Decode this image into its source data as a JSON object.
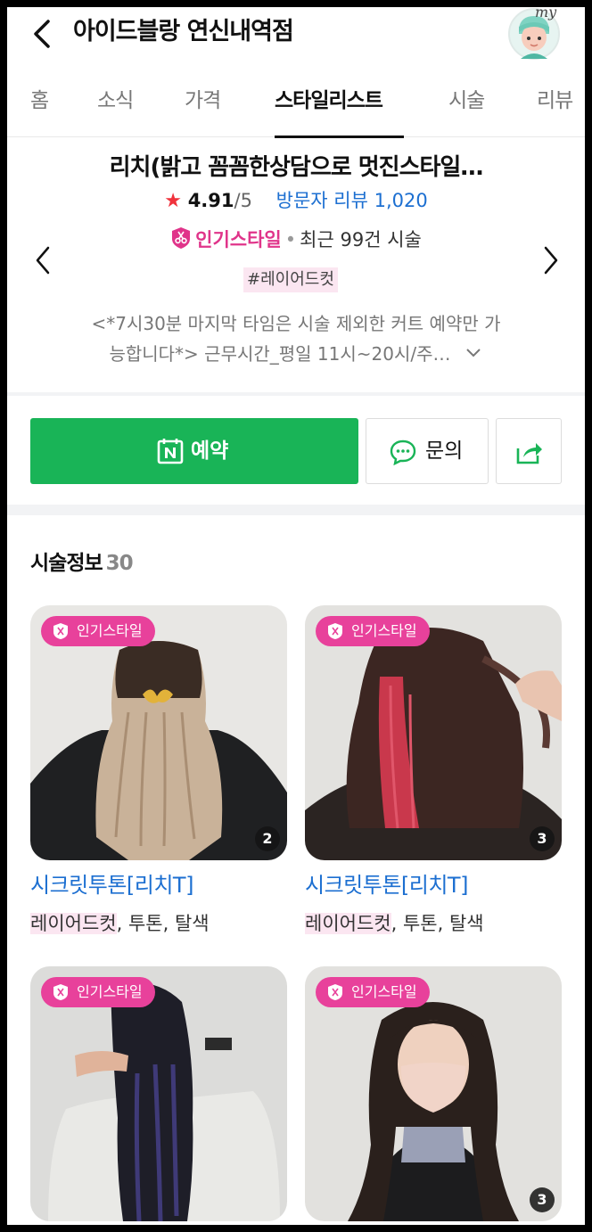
{
  "header": {
    "title": "아이드블랑 연신내역점",
    "avatar_text": "my"
  },
  "tabs": [
    {
      "label": "홈"
    },
    {
      "label": "소식"
    },
    {
      "label": "가격"
    },
    {
      "label": "스타일리스트"
    },
    {
      "label": "시술"
    },
    {
      "label": "리뷰"
    }
  ],
  "active_tab": "스타일리스트",
  "stylist": {
    "name": "리치(밝고 꼼꼼한상담으로 멋진스타일…",
    "rating": "4.91",
    "rating_max": "/5",
    "reviews_label": "방문자 리뷰 1,020",
    "popular_badge": "인기스타일",
    "recent_label": "최근 99건 시술",
    "hashtag": "#레이어드컷",
    "description_line1": "<*7시30분 마지막 타임은 시술 제외한 커트 예약만 가",
    "description_line2": "능합니다*> 근무시간_평일 11시~20시/주…"
  },
  "actions": {
    "reserve_label": "예약",
    "ask_label": "문의"
  },
  "section": {
    "title": "시술정보",
    "count": "30"
  },
  "cards": [
    {
      "badge": "인기스타일",
      "count": "2",
      "name": "시크릿투톤[리치T]",
      "tag_first": "레이어드컷",
      "tag_rest": ", 투톤, 탈색"
    },
    {
      "badge": "인기스타일",
      "count": "3",
      "name": "시크릿투톤[리치T]",
      "tag_first": "레이어드컷",
      "tag_rest": ", 투톤, 탈색"
    },
    {
      "badge": "인기스타일",
      "count": "",
      "name": "",
      "tag_first": "",
      "tag_rest": ""
    },
    {
      "badge": "인기스타일",
      "count": "3",
      "name": "",
      "tag_first": "",
      "tag_rest": ""
    }
  ],
  "colors": {
    "accent_green": "#19b457",
    "pink": "#e8419b",
    "link_blue": "#1c6fd1",
    "star_red": "#f0323c"
  }
}
